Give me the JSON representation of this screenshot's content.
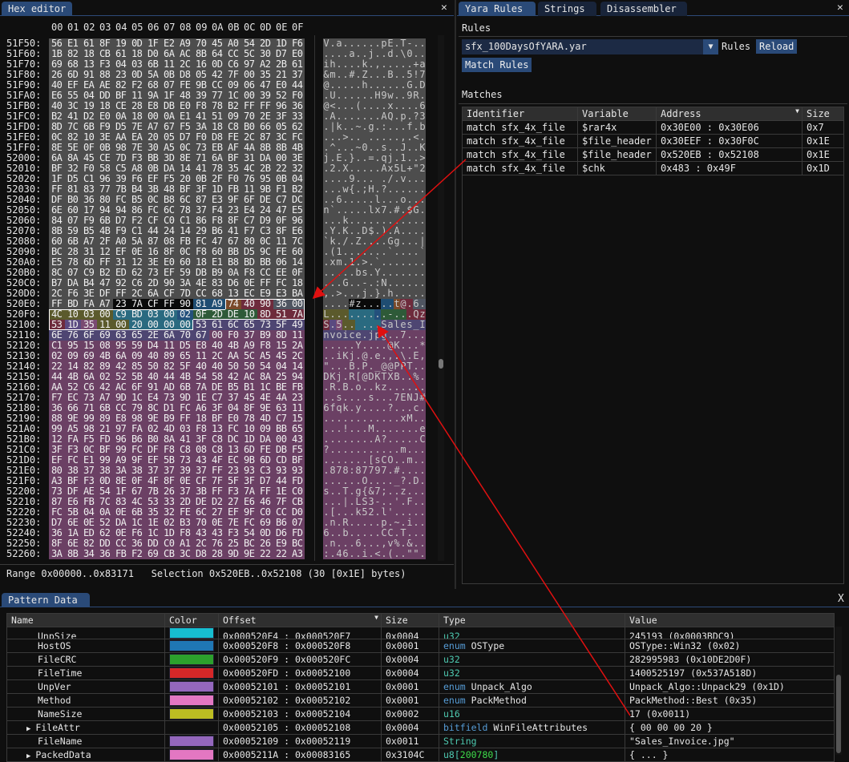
{
  "hex_editor": {
    "tab": "Hex editor",
    "close": "✕",
    "columns": [
      "00",
      "01",
      "02",
      "03",
      "04",
      "05",
      "06",
      "07",
      "08",
      "09",
      "0A",
      "0B",
      "0C",
      "0D",
      "0E",
      "0F"
    ],
    "rows": [
      [
        "51F50",
        "56 E1 61 8F 19 0D 1F E2 A9 70 45 A0 54 2D 1D F6"
      ],
      [
        "51F60",
        "1B 82 18 CB 61 18 D0 6A AC 8B 64 CC 5C 30 D7 E0"
      ],
      [
        "51F70",
        "69 68 13 F3 04 03 6B 11 2C 16 0D C6 97 A2 2B 61"
      ],
      [
        "51F80",
        "26 6D 91 88 23 0D 5A 0B D8 05 42 7F 00 35 21 37"
      ],
      [
        "51F90",
        "40 EF EA AE 82 F2 68 07 FE 9B CC 09 06 47 E0 44"
      ],
      [
        "51FA0",
        "E6 55 04 DD BF 11 9A 1F 48 39 77 1C 00 39 52 F0"
      ],
      [
        "51FB0",
        "40 3C 19 18 CE 28 E8 DB E0 F8 78 B2 FF FF 96 36"
      ],
      [
        "51FC0",
        "B2 41 D2 E0 0A 18 00 0A E1 41 51 09 70 2E 3F 33"
      ],
      [
        "51FD0",
        "8D 7C 6B F9 D5 7E A7 67 F5 3A 18 C8 B0 66 05 62"
      ],
      [
        "51FE0",
        "0C 82 10 3E AA EA 20 05 D7 F0 D8 FE 2C 87 3C FC"
      ],
      [
        "51FF0",
        "8E 5E 0F 0B 98 7E 30 A5 0C 73 EB AF 4A 8B 8B 4B"
      ],
      [
        "52000",
        "6A 8A 45 CE 7D F3 BB 3D 8E 71 6A BF 31 DA 00 3E"
      ],
      [
        "52010",
        "BF 32 F0 58 C5 A8 0B DA 14 41 78 35 4C 2B 22 32"
      ],
      [
        "52020",
        "1F D5 C1 96 39 F6 EF F5 20 0B 2F F0 76 95 0B 04"
      ],
      [
        "52030",
        "FF 81 83 77 7B B4 3B 48 BF 3F 1D FB 11 9B F1 B2"
      ],
      [
        "52040",
        "DF B0 36 80 FC B5 0C B8 6C 87 E3 9F 6F DE C7 DC"
      ],
      [
        "52050",
        "6E 60 17 94 94 86 FC 6C 78 37 F4 23 E4 24 47 E5"
      ],
      [
        "52060",
        "84 07 F9 6B D7 F2 CF C0 C1 86 F8 8F C7 D9 0F 96"
      ],
      [
        "52070",
        "8B 59 B5 4B F9 C1 44 24 14 29 B6 41 F7 C3 8F E6"
      ],
      [
        "52080",
        "60 6B A7 2F A0 5A 87 08 FB FC 47 67 80 0C 11 7C"
      ],
      [
        "52090",
        "BC 28 31 12 EF 0E 16 8F 0C F8 60 BB D5 9C FE 60"
      ],
      [
        "520A0",
        "E5 78 6D FF 31 12 3E E0 60 18 E1 B8 BD BB 06 14"
      ],
      [
        "520B0",
        "8C 07 C9 B2 ED 62 73 EF 59 DB B9 0A F8 CC EE 0F"
      ],
      [
        "520C0",
        "B7 DA B4 47 92 C6 2D 90 3A 4E 83 D6 0E FF FC 18"
      ],
      [
        "520D0",
        "2C F6 3E DF FF 2C 6A CF 7D CC 68 13 EC E9 E3 BA"
      ],
      [
        "520E0",
        "FF BD FA A7 23 7A CF FF 90 81 A9 74 40 90 36 00"
      ],
      [
        "520F0",
        "4C 10 03 00 C9 BD 03 00 02 0F 2D DE 10 8D 51 7A"
      ],
      [
        "52100",
        "53 1D 35 11 00 20 00 00 00 53 61 6C 65 73 5F 49"
      ],
      [
        "52110",
        "6E 76 6F 69 63 65 2E 6A 70 67 00 F0 37 B9 8D 11"
      ],
      [
        "52120",
        "C1 95 15 08 95 59 D4 11 D5 E8 40 4B A9 F8 15 2A"
      ],
      [
        "52130",
        "02 09 69 4B 6A 09 40 89 65 11 2C AA 5C A5 45 2C"
      ],
      [
        "52140",
        "22 14 82 89 42 85 50 82 5F 40 40 50 50 54 04 14"
      ],
      [
        "52150",
        "44 4B 6A 02 52 5B 40 44 4B 54 58 42 AC 8A 25 94"
      ],
      [
        "52160",
        "AA 52 C6 42 AC 6F 91 AD 6B 7A DE B5 B1 1C BE FB"
      ],
      [
        "52170",
        "F7 EC 73 A7 9D 1C E4 73 9D 1E C7 37 45 4E 4A 23"
      ],
      [
        "52180",
        "36 66 71 6B CC 79 8C D1 FC A6 3F 04 8F 9E 63 11"
      ],
      [
        "52190",
        "88 9E 99 89 E8 98 9E B9 FF 18 BF E0 78 4D C7 15"
      ],
      [
        "521A0",
        "99 A5 98 21 97 FA 02 4D 03 F8 13 FC 10 09 BB 65"
      ],
      [
        "521B0",
        "12 FA F5 FD 96 B6 B0 8A 41 3F C8 DC 1D DA 00 43"
      ],
      [
        "521C0",
        "3F F3 0C BF 99 FC DF F8 C8 08 C8 13 6D FE DB F5"
      ],
      [
        "521D0",
        "EF FC E1 99 A9 9F EF 5B 73 43 4F EC 9B 6D CD BF"
      ],
      [
        "521E0",
        "80 38 37 38 3A 38 37 37 39 37 FF 23 93 C3 93 93"
      ],
      [
        "521F0",
        "A3 BF F3 0D 8E 0F 4F 8F 0E CF 7F 5F 3F D7 44 FD"
      ],
      [
        "52200",
        "73 DF AE 54 1F 67 7B 26 37 3B FF F3 7A FF 1E C0"
      ],
      [
        "52210",
        "87 E6 FB 7C 83 4C 53 33 2D DE D2 27 E6 46 7F CB"
      ],
      [
        "52220",
        "FC 5B 04 0A 0E 6B 35 32 FE 6C 27 EF 9F C0 CC D0"
      ],
      [
        "52230",
        "D7 6E 0E 52 DA 1C 1E 02 B3 70 0E 7E FC 69 B6 07"
      ],
      [
        "52240",
        "36 1A ED 62 0E F6 1C 1D F8 43 43 F3 54 0D D6 FD"
      ],
      [
        "52250",
        "8F 6E 82 DD CC 36 DD C0 A1 2C 76 25 BC 26 E9 BC"
      ],
      [
        "52260",
        "3A 8B 34 36 FB F2 69 CB 3C D8 28 9D 9E 22 22 A3"
      ]
    ],
    "default_color": "#4d4d4d",
    "highlights": [
      {
        "start": "520E4",
        "end": "520E8",
        "color": "#0a0a0a"
      },
      {
        "start": "520E9",
        "end": "520EA",
        "color": "#1f4d72"
      },
      {
        "start": "520EB",
        "end": "520EB",
        "color": "#7a4a2a"
      },
      {
        "start": "520EC",
        "end": "520ED",
        "color": "#6e2b3c"
      },
      {
        "start": "520EE",
        "end": "520EF",
        "color": "#4f5561"
      },
      {
        "start": "520F0",
        "end": "520F3",
        "color": "#5b5a2c"
      },
      {
        "start": "520F4",
        "end": "520F7",
        "color": "#2a6a80"
      },
      {
        "start": "520F8",
        "end": "520F8",
        "color": "#24507c"
      },
      {
        "start": "520F9",
        "end": "520FC",
        "color": "#2e5a38"
      },
      {
        "start": "520FD",
        "end": "52100",
        "color": "#6e2b3c"
      },
      {
        "start": "52101",
        "end": "52101",
        "color": "#5a4a80"
      },
      {
        "start": "52102",
        "end": "52102",
        "color": "#7a4a72"
      },
      {
        "start": "52103",
        "end": "52104",
        "color": "#5b5a2c"
      },
      {
        "start": "52105",
        "end": "52108",
        "color": "#2a6a80"
      },
      {
        "start": "52109",
        "end": "52119",
        "color": "#4e4672"
      },
      {
        "start": "5211A",
        "end": "5226F",
        "color": "#6b4064"
      }
    ],
    "selection": {
      "start": "520EB",
      "end": "52108"
    },
    "status": "Range 0x00000..0x83171   Selection 0x520EB..0x52108 (30 [0x1E] bytes)"
  },
  "right_panel": {
    "tabs": [
      "Yara Rules",
      "Strings",
      "Disassembler"
    ],
    "close": "✕",
    "rules_label": "Rules",
    "rule_file": "sfx_100DaysOfYARA.yar",
    "combo_suffix": "Rules",
    "reload": "Reload",
    "match_rules": "Match Rules",
    "matches_label": "Matches",
    "columns": [
      "Identifier",
      "Variable",
      "Address",
      "Size"
    ],
    "rows": [
      [
        "match sfx_4x_file",
        "$rar4x",
        "0x30E00 : 0x30E06",
        "0x7"
      ],
      [
        "match sfx_4x_file",
        "$file_header",
        "0x30EEF : 0x30F0C",
        "0x1E"
      ],
      [
        "match sfx_4x_file",
        "$file_header",
        "0x520EB : 0x52108",
        "0x1E"
      ],
      [
        "match sfx_4x_file",
        "$chk",
        "0x483 : 0x49F",
        "0x1D"
      ]
    ]
  },
  "pattern_data": {
    "tab": "Pattern Data",
    "close": "X",
    "columns": [
      "Name",
      "Color",
      "Offset",
      "Size",
      "Type",
      "Value"
    ],
    "rows": [
      {
        "name": "UnpSize",
        "color": "#17becf",
        "offset": "0x000520F4 : 0x000520F7",
        "size": "0x0004",
        "kw": "",
        "type": "u32",
        "value": "245193 (0x0003BDC9)"
      },
      {
        "name": "HostOS",
        "color": "#1f77b4",
        "offset": "0x000520F8 : 0x000520F8",
        "size": "0x0001",
        "kw": "enum",
        "type": "OSType",
        "value": "OSType::Win32 (0x02)"
      },
      {
        "name": "FileCRC",
        "color": "#2ca02c",
        "offset": "0x000520F9 : 0x000520FC",
        "size": "0x0004",
        "kw": "",
        "type": "u32",
        "value": "282995983 (0x10DE2D0F)"
      },
      {
        "name": "FileTime",
        "color": "#d62728",
        "offset": "0x000520FD : 0x00052100",
        "size": "0x0004",
        "kw": "",
        "type": "u32",
        "value": "1400525197 (0x537A518D)"
      },
      {
        "name": "UnpVer",
        "color": "#9467bd",
        "offset": "0x00052101 : 0x00052101",
        "size": "0x0001",
        "kw": "enum",
        "type": "Unpack_Algo",
        "value": "Unpack_Algo::Unpack29 (0x1D)"
      },
      {
        "name": "Method",
        "color": "#e377c2",
        "offset": "0x00052102 : 0x00052102",
        "size": "0x0001",
        "kw": "enum",
        "type": "PackMethod",
        "value": "PackMethod::Best (0x35)"
      },
      {
        "name": "NameSize",
        "color": "#bcbd22",
        "offset": "0x00052103 : 0x00052104",
        "size": "0x0002",
        "kw": "",
        "type": "u16",
        "value": "17 (0x0011)"
      },
      {
        "name": "FileAttr",
        "expand": "▶",
        "color": "",
        "offset": "0x00052105 : 0x00052108",
        "size": "0x0004",
        "kw": "bitfield",
        "type": "WinFileAttributes",
        "value": "{ 00 00 00 20 }"
      },
      {
        "name": "FileName",
        "color": "#9467bd",
        "offset": "0x00052109 : 0x00052119",
        "size": "0x0011",
        "kw": "",
        "type": "String",
        "value": "\"Sales_Invoice.jpg\""
      },
      {
        "name": "PackedData",
        "expand": "▶",
        "color": "#e377c2",
        "offset": "0x0005211A : 0x00083165",
        "size": "0x3104C",
        "kw": "",
        "type": "u8[",
        "count": "200780",
        "type_end": "]",
        "value": "{ ... }"
      }
    ]
  },
  "annotation_color": "#e01010"
}
